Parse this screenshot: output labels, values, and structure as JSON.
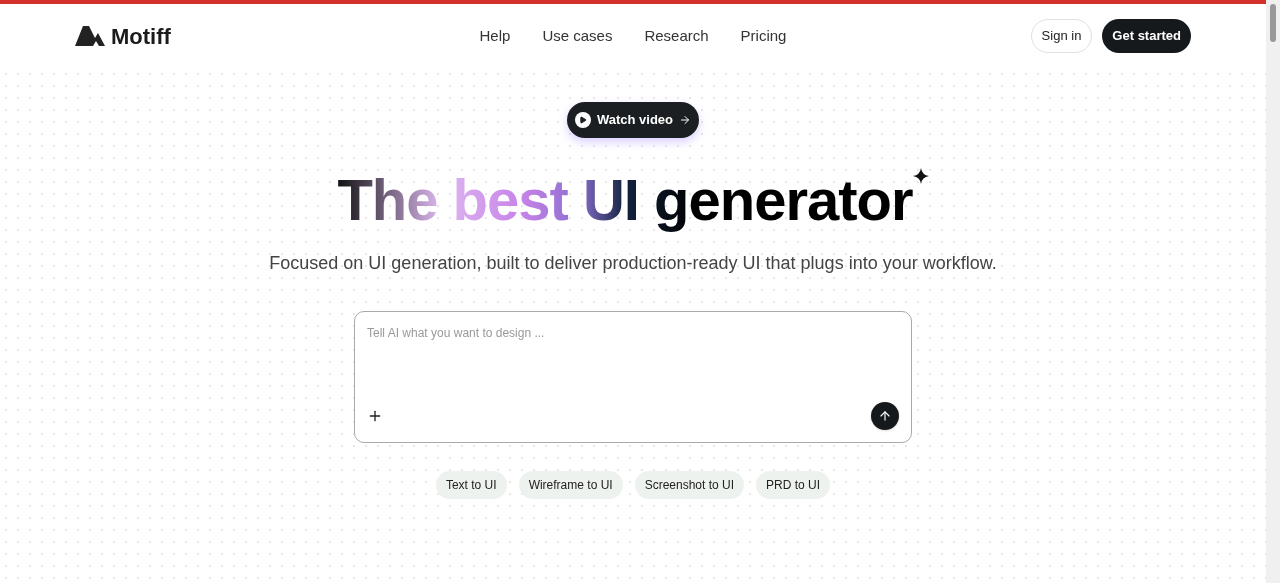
{
  "header": {
    "logo": "Motiff",
    "nav": [
      "Help",
      "Use cases",
      "Research",
      "Pricing"
    ],
    "sign_in": "Sign in",
    "get_started": "Get started"
  },
  "hero": {
    "video_button": "Watch video",
    "title": "The best UI generator",
    "subtitle": "Focused on UI generation, built to deliver production-ready UI that plugs into your workflow."
  },
  "prompt": {
    "placeholder": "Tell AI what you want to design ..."
  },
  "chips": [
    "Text to UI",
    "Wireframe to UI",
    "Screenshot to UI",
    "PRD to UI"
  ]
}
